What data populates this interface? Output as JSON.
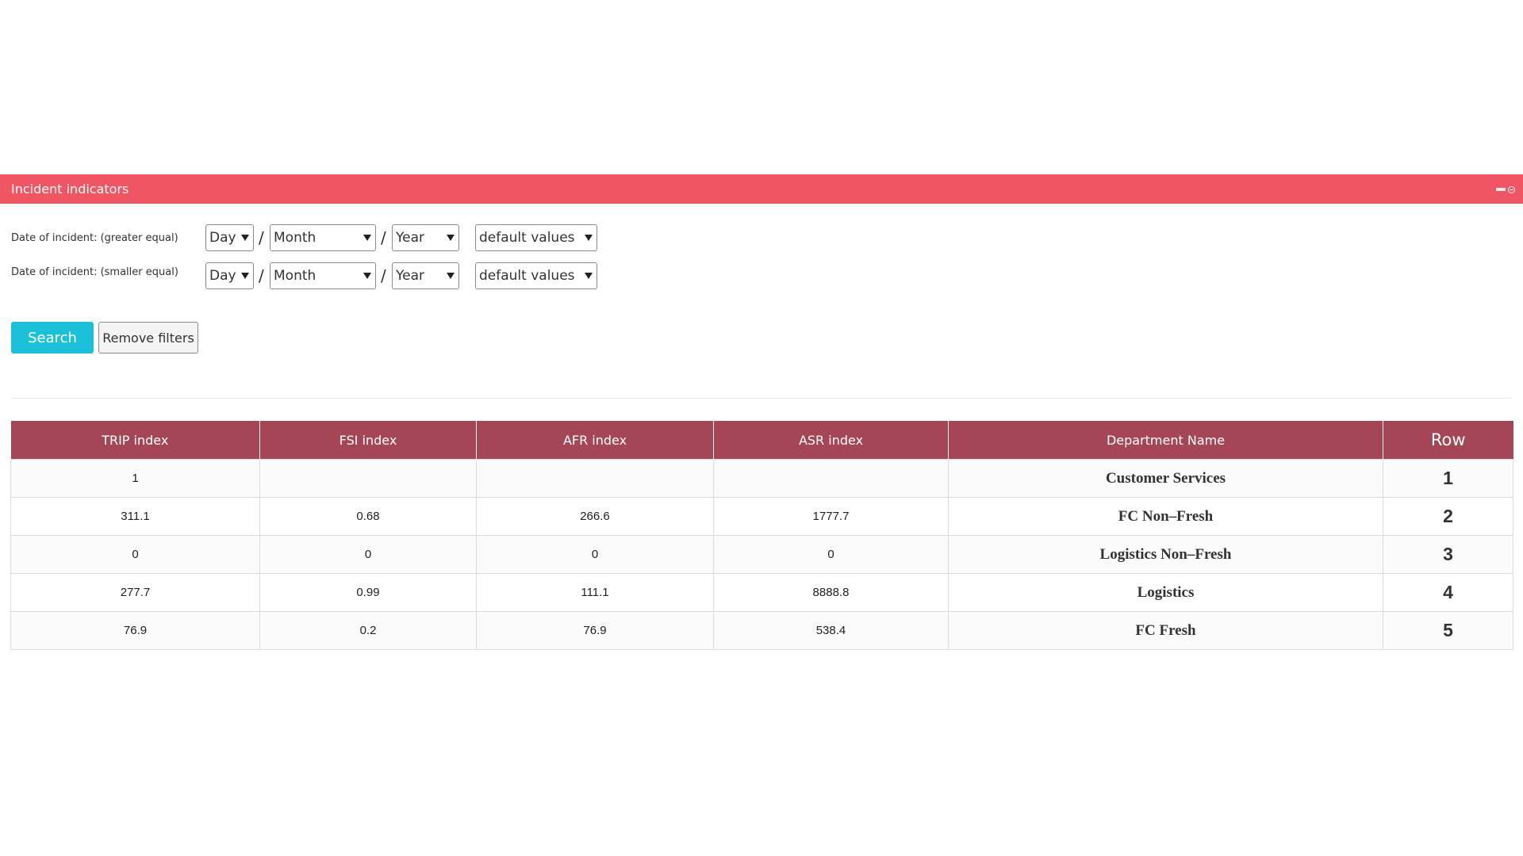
{
  "panel": {
    "title": "Incident indicators"
  },
  "filters": {
    "greater": {
      "label": "Date of incident: (greater equal)",
      "day": "Day",
      "month": "Month",
      "year": "Year",
      "preset": "default values"
    },
    "smaller": {
      "label": "Date of incident: (smaller equal)",
      "day": "Day",
      "month": "Month",
      "year": "Year",
      "preset": "default values"
    },
    "separator": "/"
  },
  "buttons": {
    "search": "Search",
    "remove_filters": "Remove filters"
  },
  "table": {
    "headers": [
      "TRIP index",
      "FSI index",
      "AFR index",
      "ASR index",
      "Department Name",
      "Row"
    ],
    "rows": [
      [
        "1",
        "",
        "",
        "",
        "Customer Services",
        "1"
      ],
      [
        "311.1",
        "0.68",
        "266.6",
        "1777.7",
        "FC Non–Fresh",
        "2"
      ],
      [
        "0",
        "0",
        "0",
        "0",
        "Logistics Non–Fresh",
        "3"
      ],
      [
        "277.7",
        "0.99",
        "111.1",
        "8888.8",
        "Logistics",
        "4"
      ],
      [
        "76.9",
        "0.2",
        "76.9",
        "538.4",
        "FC Fresh",
        "5"
      ]
    ]
  },
  "colors": {
    "header_bar": "#f05563",
    "table_header": "#a54656",
    "search_button": "#1cc1d9"
  }
}
